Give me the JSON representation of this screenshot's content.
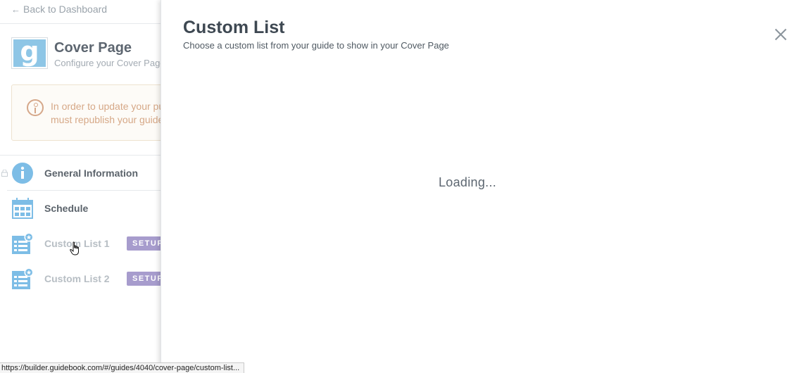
{
  "sidebar": {
    "back_link": "Back to Dashboard",
    "app": {
      "logo_letter": "g",
      "title": "Cover Page",
      "subtitle": "Configure your Cover Page"
    },
    "warning": {
      "line1": "In order to update your published guide, you",
      "line2": "must republish your guide."
    },
    "items": [
      {
        "label": "General Information",
        "icon": "info-icon",
        "locked": true
      },
      {
        "label": "Schedule",
        "icon": "calendar-icon"
      },
      {
        "label": "Custom List 1",
        "icon": "custom-list-icon",
        "badge": "SETUP"
      },
      {
        "label": "Custom List 2",
        "icon": "custom-list-icon",
        "badge": "SETUP"
      }
    ]
  },
  "modal": {
    "title": "Custom List",
    "subtitle": "Choose a custom list from your guide to show in your Cover Page",
    "loading_text": "Loading..."
  },
  "status_bar": {
    "url": "https://builder.guidebook.com/#/guides/4040/cover-page/custom-list..."
  },
  "colors": {
    "icon_blue": "#7dbde6",
    "badge_purple": "#a79ccd",
    "warning_text": "#d6a887"
  }
}
